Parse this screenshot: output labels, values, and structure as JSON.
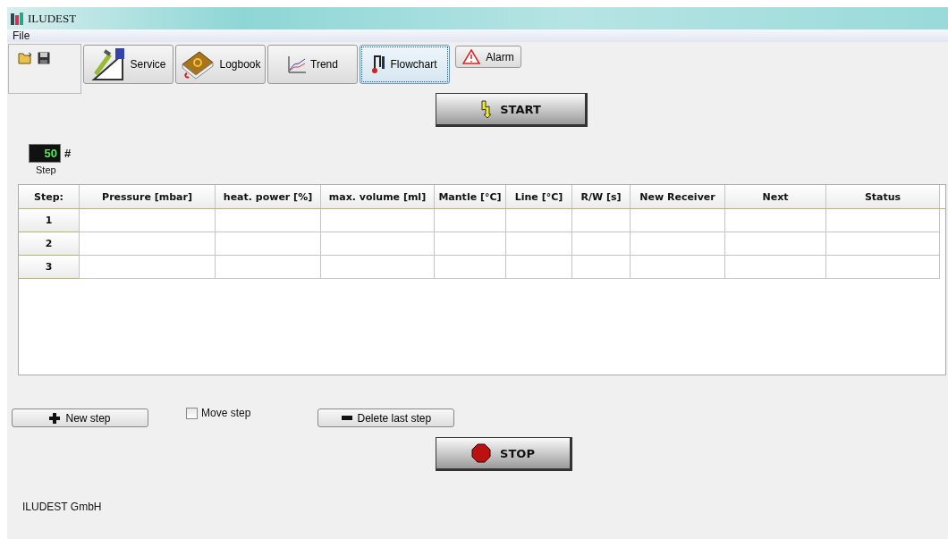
{
  "window": {
    "title": "ILUDEST"
  },
  "menu": [
    "File"
  ],
  "tabs": [
    {
      "label": "Service",
      "kind": "service",
      "selected": false
    },
    {
      "label": "Logbook",
      "kind": "logbook",
      "selected": false
    },
    {
      "label": "Trend",
      "kind": "trend",
      "selected": false
    },
    {
      "label": "Flowchart",
      "kind": "flowchart",
      "selected": true
    }
  ],
  "alarm_button": "Alarm",
  "start_button": "START",
  "step_counter": {
    "value": "50",
    "unit": "#",
    "label": "Step"
  },
  "table": {
    "columns": [
      "Step:",
      "Pressure [mbar]",
      "heat. power [%]",
      "max. volume [ml]",
      "Mantle [°C]",
      "Line [°C]",
      "R/W [s]",
      "New Receiver",
      "Next",
      "Status"
    ],
    "rows": [
      "1",
      "2",
      "3"
    ]
  },
  "new_step_button": "New step",
  "move_step": {
    "label": "Move step",
    "checked": false
  },
  "delete_button": "Delete last step",
  "stop_button": "STOP",
  "footer": "ILUDEST GmbH"
}
